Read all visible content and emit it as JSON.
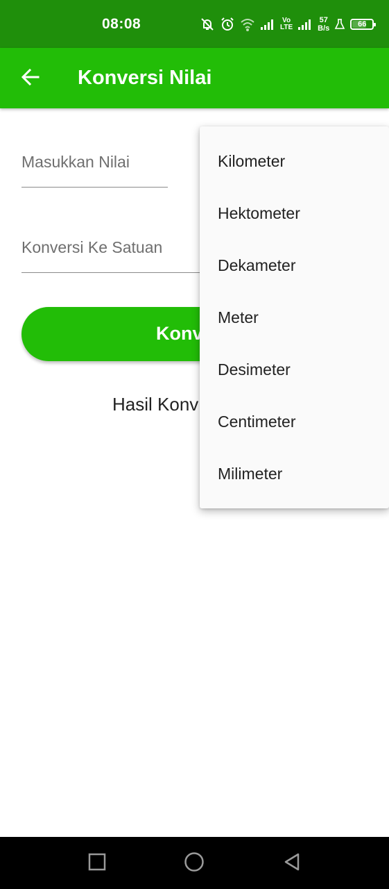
{
  "status_bar": {
    "time": "08:08",
    "volte_top": "Vo",
    "volte_bottom": "LTE",
    "net_speed_value": "57",
    "net_speed_unit": "B/s",
    "battery_level": "66"
  },
  "app_bar": {
    "title": "Konversi Nilai",
    "back_icon": "arrow-left-icon"
  },
  "form": {
    "value_placeholder": "Masukkan Nilai",
    "unit_placeholder": "Konversi Ke Satuan",
    "convert_label": "Konv",
    "result_label": "Hasil Konv"
  },
  "dropdown": {
    "items": [
      "Kilometer",
      "Hektometer",
      "Dekameter",
      "Meter",
      "Desimeter",
      "Centimeter",
      "Milimeter"
    ]
  },
  "nav_bar": {
    "icons": [
      "recent-apps-icon",
      "home-icon",
      "back-icon"
    ]
  },
  "colors": {
    "status_bar": "#1f8f0b",
    "primary": "#22bd07",
    "menu_bg": "#fafafa",
    "nav_bar": "#000000"
  }
}
